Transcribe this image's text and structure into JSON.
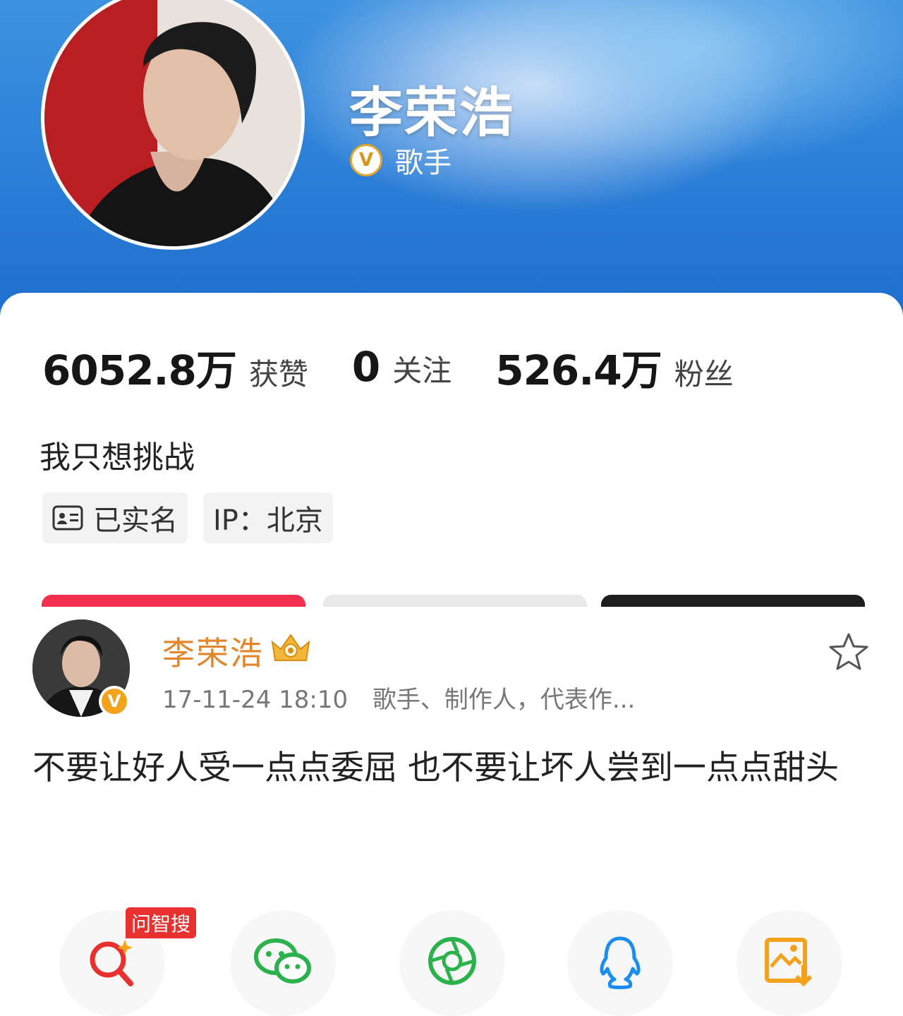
{
  "profile": {
    "name": "李荣浩",
    "verify_badge": "V",
    "verify_title": "歌手",
    "stats": [
      {
        "value": "6052.8万",
        "label": "获赞"
      },
      {
        "value": "0",
        "label": "关注"
      },
      {
        "value": "526.4万",
        "label": "粉丝"
      }
    ],
    "bio": "我只想挑战",
    "tags": {
      "realname": "已实名",
      "ip": "IP：北京"
    }
  },
  "buttons_colors": {
    "primary": "#f0304d",
    "secondary": "#e9e9e9",
    "dark": "#1e1e1e"
  },
  "post": {
    "author": "李荣浩",
    "author_badge": "V",
    "timestamp": "17-11-24 18:10",
    "author_desc": "歌手、制作人，代表作...",
    "content": "不要让好人受一点点委屈 也不要让坏人尝到一点点甜头"
  },
  "share": {
    "ai_badge": "问智搜",
    "items": [
      "ai-search-icon",
      "wechat-icon",
      "moments-icon",
      "qq-icon",
      "save-image-icon"
    ]
  }
}
